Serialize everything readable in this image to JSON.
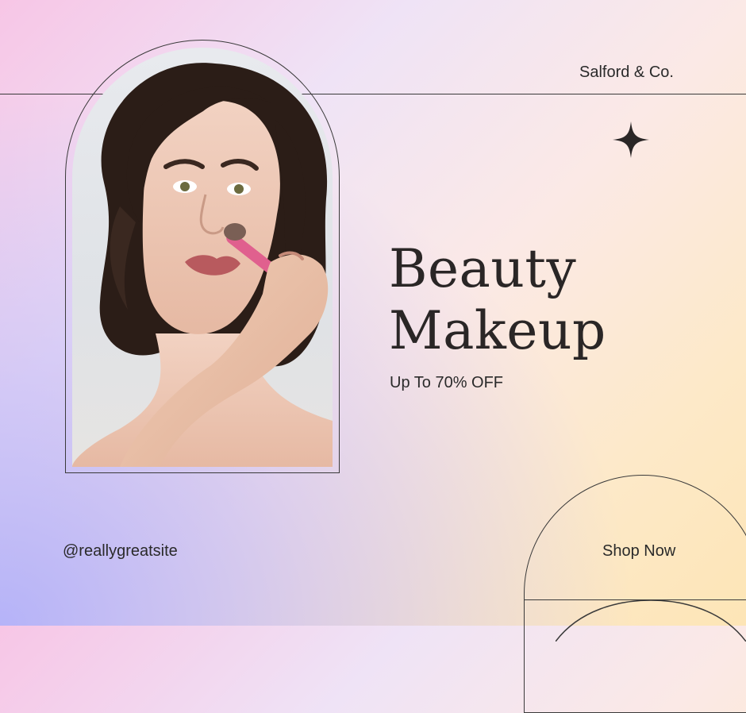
{
  "brand": "Salford & Co.",
  "headline": {
    "line1": "Beauty",
    "line2": "Makeup"
  },
  "offer": "Up To 70% OFF",
  "social_handle": "@reallygreatsite",
  "cta_label": "Shop Now",
  "icons": {
    "sparkle": "four-point-star-icon"
  },
  "colors": {
    "text": "#2a2626",
    "line": "#3a3a3a",
    "brush_pink": "#e0608e"
  }
}
